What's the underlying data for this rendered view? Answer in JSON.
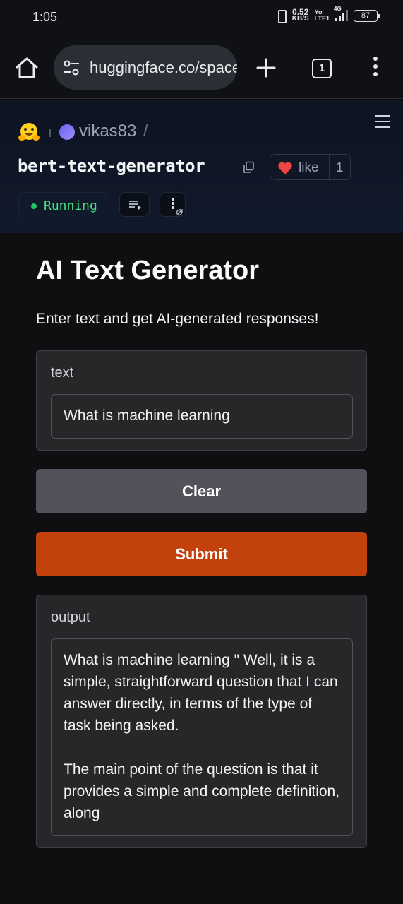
{
  "status_bar": {
    "time": "1:05",
    "net_speed_value": "0.52",
    "net_speed_unit": "KB/S",
    "volte_top": "Yo",
    "volte_bottom": "LTE1",
    "network": "4G",
    "battery": "87"
  },
  "browser": {
    "url": "huggingface.co/spaces",
    "tab_count": "1",
    "icons": {
      "home": "home-icon",
      "site_info": "tune-icon",
      "new_tab": "plus-icon",
      "tabs": "tab-switcher-icon",
      "menu": "kebab-menu-icon"
    }
  },
  "space_header": {
    "owner": "vikas83",
    "separator": "/",
    "space_name": "bert-text-generator",
    "like_label": "like",
    "like_count": "1",
    "status": "Running",
    "colors": {
      "status_green": "#22c55e",
      "heart_red": "#ef4444"
    }
  },
  "app": {
    "title": "AI Text Generator",
    "description": "Enter text and get AI-generated responses!",
    "input_label": "text",
    "input_value": "What is machine learning",
    "clear_label": "Clear",
    "submit_label": "Submit",
    "output_label": "output",
    "output_value": "What is machine learning \" Well, it is a simple, straightforward question that I can answer directly, in terms of the type of task being asked.\n\nThe main point of the question is that it provides a simple and complete definition, along",
    "colors": {
      "submit": "#c2410c",
      "clear": "#52525b"
    }
  }
}
